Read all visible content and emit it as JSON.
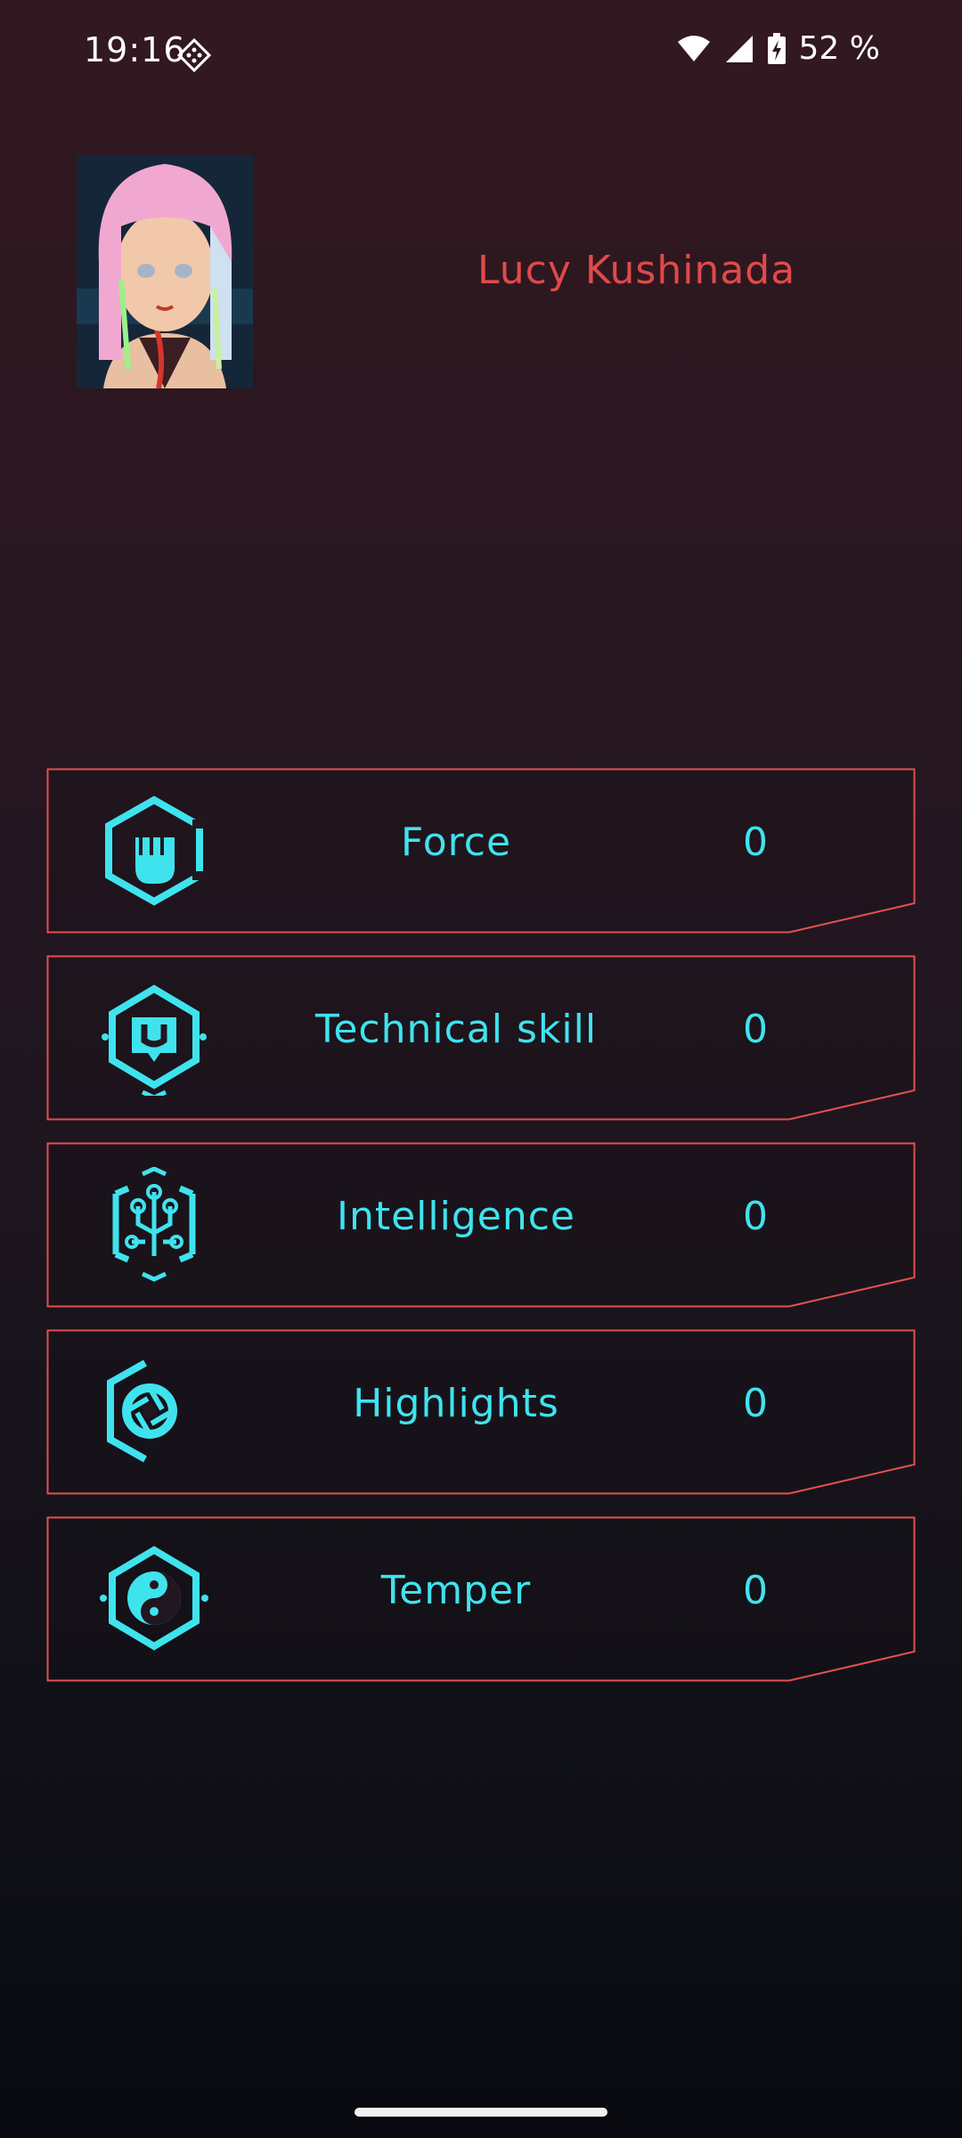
{
  "status_bar": {
    "time": "19:16",
    "battery_percent": "52 %",
    "icons": [
      "notification-diamond-icon",
      "wifi-icon",
      "signal-icon",
      "battery-charging-icon"
    ]
  },
  "profile": {
    "name": "Lucy Kushinada",
    "avatar_icon": "character-portrait"
  },
  "stats": [
    {
      "label": "Force",
      "value": "0",
      "icon": "fist-icon"
    },
    {
      "label": "Technical skill",
      "value": "0",
      "icon": "wrench-icon"
    },
    {
      "label": "Intelligence",
      "value": "0",
      "icon": "circuit-icon"
    },
    {
      "label": "Highlights",
      "value": "0",
      "icon": "aperture-icon"
    },
    {
      "label": "Temper",
      "value": "0",
      "icon": "yin-yang-icon"
    }
  ],
  "colors": {
    "accent_cyan": "#3fe3ee",
    "accent_red": "#e04a4a"
  }
}
